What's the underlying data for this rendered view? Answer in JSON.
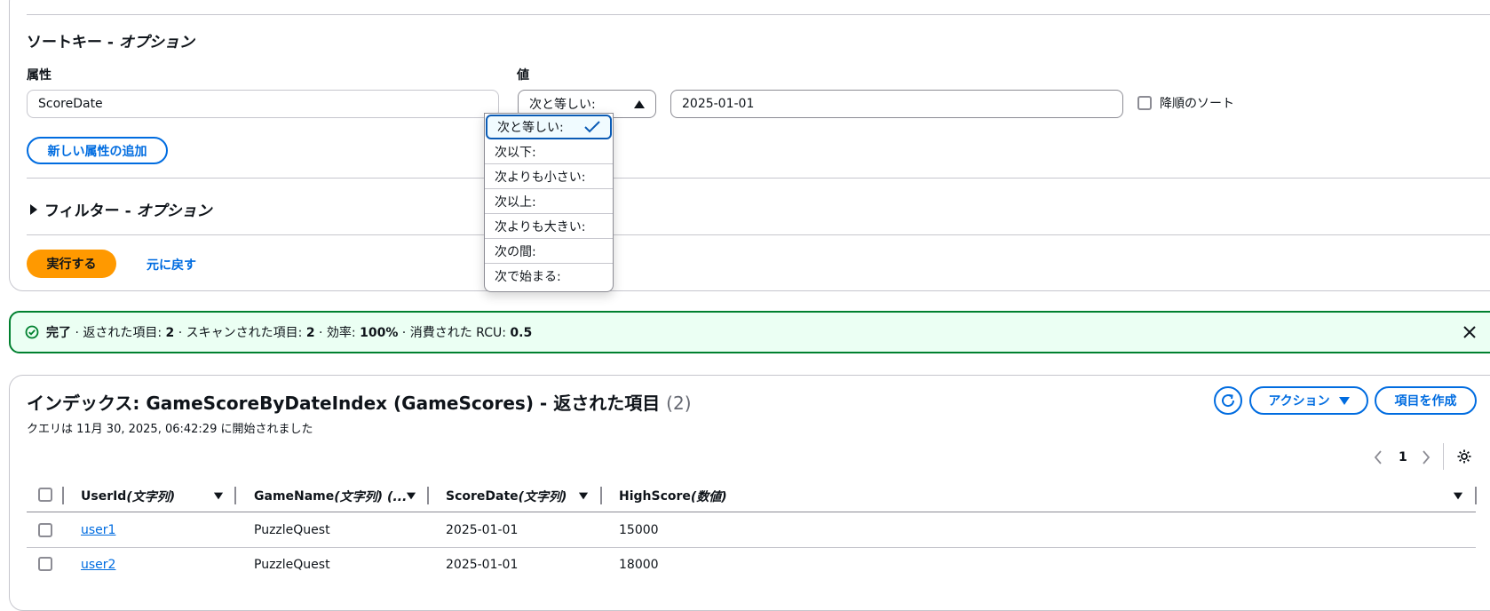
{
  "query": {
    "sort_key_title": "ソートキー - ",
    "sort_key_title_em": "オプション",
    "attribute_label": "属性",
    "attribute_value": "ScoreDate",
    "value_label": "値",
    "operator_selected": "次と等しい:",
    "value_input": "2025-01-01",
    "descending_label": "降順のソート",
    "add_attribute_label": "新しい属性の追加",
    "filter_title": "フィルター - ",
    "filter_title_em": "オプション",
    "run_label": "実行する",
    "reset_label": "元に戻す"
  },
  "operator_options": [
    "次と等しい:",
    "次以下:",
    "次よりも小さい:",
    "次以上:",
    "次よりも大きい:",
    "次の間:",
    "次で始まる:"
  ],
  "alert": {
    "status": "完了",
    "returned_label": " · 返された項目: ",
    "returned_value": "2",
    "scanned_label": " · スキャンされた項目: ",
    "scanned_value": "2",
    "efficiency_label": " · 効率: ",
    "efficiency_value": "100%",
    "rcu_label": " · 消費された RCU: ",
    "rcu_value": "0.5"
  },
  "results": {
    "title": "インデックス: GameScoreByDateIndex (GameScores) - 返された項目",
    "count": "(2)",
    "subtitle": "クエリは 11月 30, 2025, 06:42:29 に開始されました",
    "actions_label": "アクション",
    "create_label": "項目を作成",
    "page": "1",
    "columns": [
      {
        "name": "UserId ",
        "type": "(文字列)"
      },
      {
        "name": "GameName ",
        "type": "(文字列) (..."
      },
      {
        "name": "ScoreDate ",
        "type": "(文字列)"
      },
      {
        "name": "HighScore ",
        "type": "(数値)"
      }
    ],
    "rows": [
      {
        "user": "user1",
        "game": "PuzzleQuest",
        "date": "2025-01-01",
        "score": "15000"
      },
      {
        "user": "user2",
        "game": "PuzzleQuest",
        "date": "2025-01-01",
        "score": "18000"
      }
    ]
  },
  "colors": {
    "accent": "#006ce0",
    "primary": "#ff9900",
    "success": "#00802f"
  }
}
